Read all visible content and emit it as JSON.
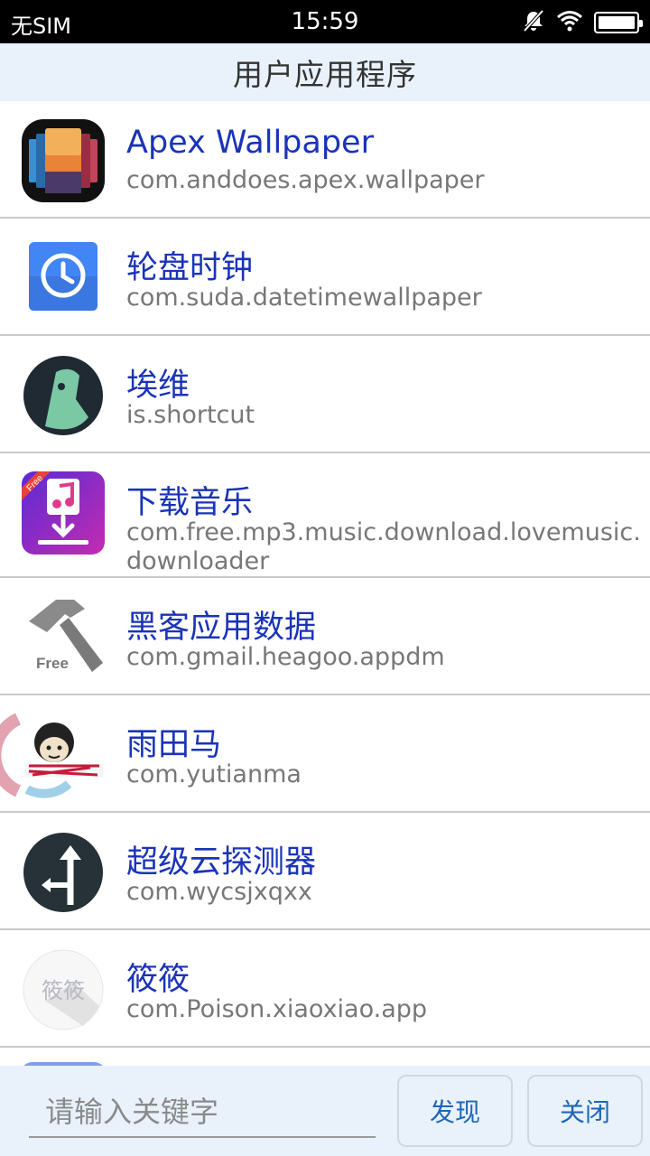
{
  "status_bar": {
    "carrier": "无SIM",
    "time": "15:59",
    "icons": [
      "mute-icon",
      "wifi-icon",
      "battery-icon"
    ]
  },
  "header": {
    "title": "用户应用程序"
  },
  "apps": [
    {
      "name": "Apex Wallpaper",
      "package": "com.anddoes.apex.wallpaper",
      "icon": "apex-wallpaper-icon"
    },
    {
      "name": "轮盘时钟",
      "package": "com.suda.datetimewallpaper",
      "icon": "clock-icon"
    },
    {
      "name": "埃维",
      "package": "is.shortcut",
      "icon": "shortcut-icon"
    },
    {
      "name": "下载音乐",
      "package": "com.free.mp3.music.download.lovemusic.downloader",
      "icon": "music-download-icon",
      "icon_badge": "Free"
    },
    {
      "name": "黑客应用数据",
      "package": "com.gmail.heagoo.appdm",
      "icon": "hammer-icon",
      "icon_badge": "Free"
    },
    {
      "name": "雨田马",
      "package": "com.yutianma",
      "icon": "yutianma-icon"
    },
    {
      "name": "超级云探测器",
      "package": "com.wycsjxqxx",
      "icon": "direction-arrow-icon"
    },
    {
      "name": "筱筱",
      "package": "com.Poison.xiaoxiao.app",
      "icon": "xiaoxiao-icon",
      "icon_text": "筱筱"
    }
  ],
  "bottom_bar": {
    "search_placeholder": "请输入关键字",
    "discover_label": "发现",
    "close_label": "关闭"
  },
  "colors": {
    "app_name": "#1a33b8",
    "package": "#777777",
    "header_bg": "#e9f2fb",
    "button_text": "#1f66b8"
  }
}
